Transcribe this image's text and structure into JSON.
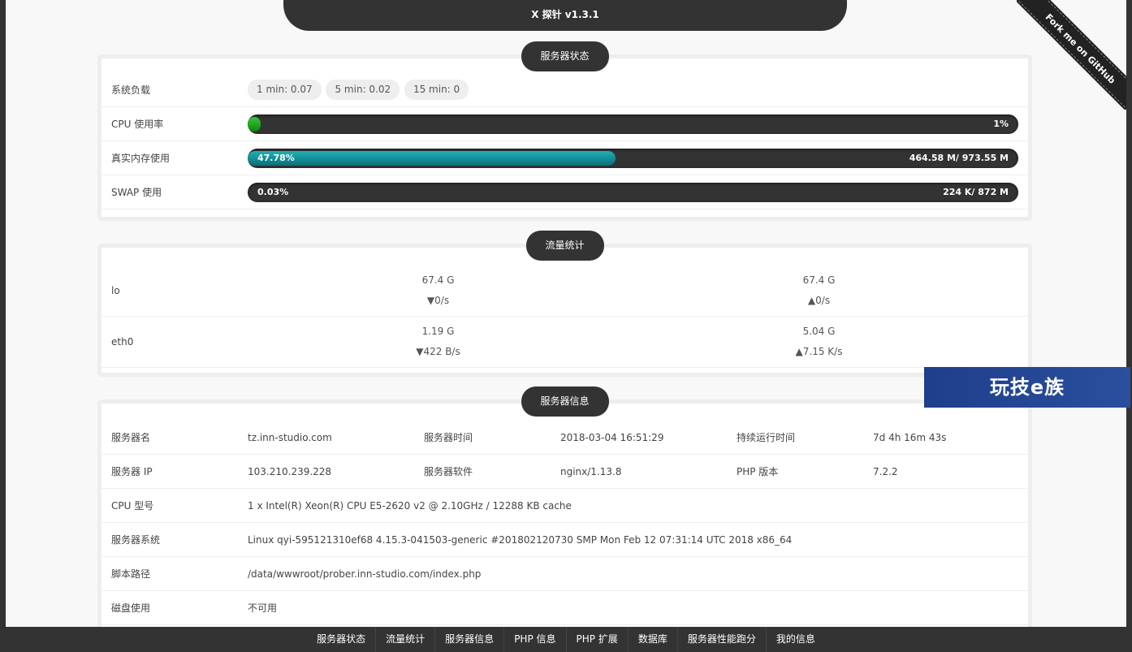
{
  "app": {
    "title": "X 探针 v1.3.1",
    "ribbon": "Fork me on GitHub"
  },
  "status": {
    "title": "服务器状态",
    "load_label": "系统负载",
    "load": [
      "1 min: 0.07",
      "5 min: 0.02",
      "15 min: 0"
    ],
    "cpu": {
      "label": "CPU 使用率",
      "percent_text": "1%",
      "fraction": 0.01
    },
    "mem": {
      "label": "真实内存使用",
      "percent_text": "47.78%",
      "usage": "464.58 M/ 973.55 M",
      "fraction": 0.4778
    },
    "swap": {
      "label": "SWAP 使用",
      "percent_text": "0.03%",
      "usage": "224 K/ 872 M",
      "fraction": 0.0003
    }
  },
  "traffic": {
    "title": "流量统计",
    "rows": [
      {
        "name": "lo",
        "rx_total": "67.4 G",
        "rx_rate": "▼0/s",
        "tx_total": "67.4 G",
        "tx_rate": "▲0/s"
      },
      {
        "name": "eth0",
        "rx_total": "1.19 G",
        "rx_rate": "▼422 B/s",
        "tx_total": "5.04 G",
        "tx_rate": "▲7.15 K/s"
      }
    ]
  },
  "info": {
    "title": "服务器信息",
    "server_name_label": "服务器名",
    "server_name": "tz.inn-studio.com",
    "server_time_label": "服务器时间",
    "server_time": "2018-03-04 16:51:29",
    "uptime_label": "持续运行时间",
    "uptime": "7d 4h 16m 43s",
    "ip_label": "服务器 IP",
    "ip": "103.210.239.228",
    "software_label": "服务器软件",
    "software": "nginx/1.13.8",
    "php_label": "PHP 版本",
    "php": "7.2.2",
    "cpu_model_label": "CPU 型号",
    "cpu_model": "1 x Intel(R) Xeon(R) CPU E5-2620 v2 @ 2.10GHz / 12288 KB cache",
    "os_label": "服务器系统",
    "os": "Linux qyi-595121310ef68 4.15.3-041503-generic #201802120730 SMP Mon Feb 12 07:31:14 UTC 2018 x86_64",
    "path_label": "脚本路径",
    "path": "/data/wwwroot/prober.inn-studio.com/index.php",
    "disk_label": "磁盘使用",
    "disk": "不可用"
  },
  "nav": [
    "服务器状态",
    "流量统计",
    "服务器信息",
    "PHP 信息",
    "PHP 扩展",
    "数据库",
    "服务器性能跑分",
    "我的信息"
  ],
  "watermark": "玩技e族",
  "colors": {
    "dark": "#333333",
    "green": "#0a8a0a",
    "teal": "#0a7078",
    "bg": "#f8f8f8"
  }
}
